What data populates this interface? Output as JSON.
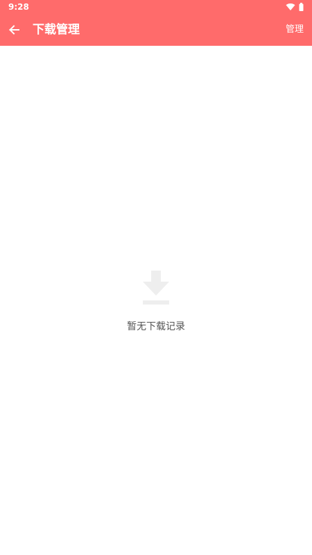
{
  "status_bar": {
    "time": "9:28",
    "icons": [
      "wifi-icon",
      "battery-icon"
    ]
  },
  "toolbar": {
    "back_icon": "arrow-left-icon",
    "title": "下载管理",
    "manage_label": "管理"
  },
  "empty_state": {
    "icon": "download-icon",
    "message": "暂无下载记录"
  },
  "colors": {
    "accent": "#ff6b6b",
    "header_text": "#ffffff",
    "empty_icon": "#eeeeee",
    "empty_text": "#555555",
    "background": "#ffffff"
  }
}
